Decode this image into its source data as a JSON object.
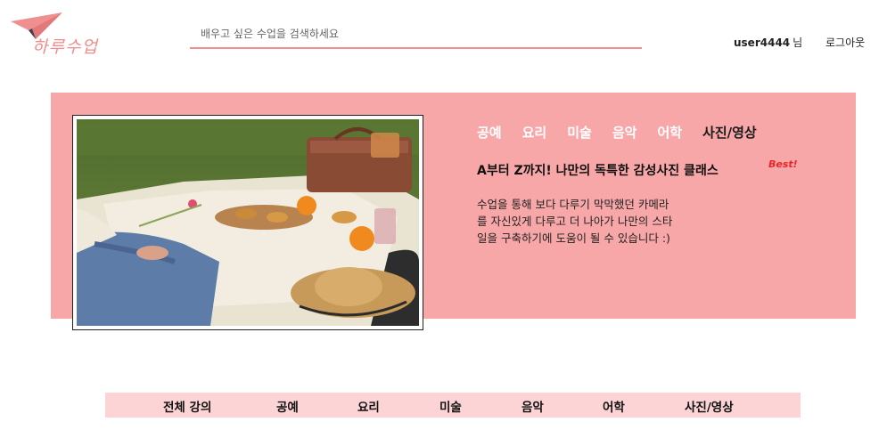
{
  "header": {
    "logo_text": "하루수업",
    "search": {
      "placeholder": "배우고 싶은 수업을 검색하세요",
      "value": ""
    },
    "user": {
      "name": "user4444",
      "suffix": "님"
    },
    "logout_label": "로그아웃"
  },
  "banner": {
    "categories": [
      {
        "label": "공예",
        "active": false
      },
      {
        "label": "요리",
        "active": false
      },
      {
        "label": "미술",
        "active": false
      },
      {
        "label": "음악",
        "active": false
      },
      {
        "label": "어학",
        "active": false
      },
      {
        "label": "사진/영상",
        "active": true
      }
    ],
    "headline": "A부터 Z까지! 나만의 독특한 감성사진 클래스",
    "badge": "Best!",
    "description_lines": [
      "수업을 통해 보다 다루기 막막했던 카메라",
      "를 자신있게 다루고 더 나아가 나만의 스타",
      "일을 구축하기에 도움이 될 수 있습니다 :)"
    ]
  },
  "tabs": [
    "전체 강의",
    "공예",
    "요리",
    "미술",
    "음악",
    "어학",
    "사진/영상"
  ],
  "colors": {
    "banner_bg": "#f8a7a8",
    "accent": "#ef8f8f",
    "tabbar_bg": "#fcd4d6",
    "badge": "#e8262a"
  }
}
